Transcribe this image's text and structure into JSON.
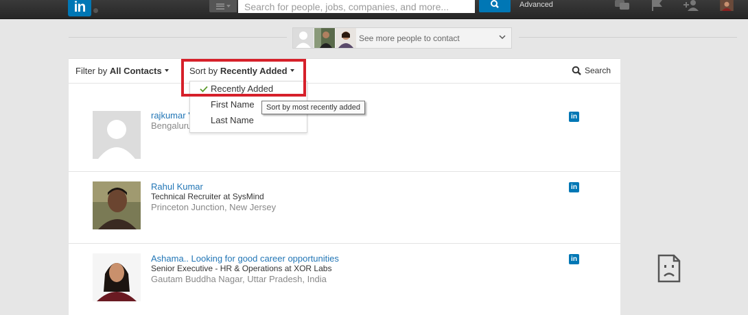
{
  "navbar": {
    "logo_text": "in",
    "search_placeholder": "Search for people, jobs, companies, and more...",
    "advanced_label": "Advanced",
    "icons": [
      "messages-icon",
      "flag-icon",
      "add-connection-icon",
      "profile-photo"
    ]
  },
  "people_strip": {
    "label": "See more people to contact"
  },
  "filter_bar": {
    "filter_prefix": "Filter by",
    "filter_value": "All Contacts",
    "sort_prefix": "Sort by",
    "sort_value": "Recently Added",
    "search_label": "Search"
  },
  "sort_menu": {
    "items": [
      "Recently Added",
      "First Name",
      "Last Name"
    ],
    "selected": "Recently Added",
    "tooltip": "Sort by most recently added"
  },
  "contacts": [
    {
      "name": "rajkumar '",
      "headline": "",
      "location": "Bengaluru",
      "badge": "in"
    },
    {
      "name": "Rahul Kumar",
      "headline": "Technical Recruiter at SysMind",
      "location": "Princeton Junction, New Jersey",
      "badge": "in"
    },
    {
      "name": "Ashama.. Looking for good career opportunities",
      "headline": "Senior Executive - HR & Operations at XOR Labs",
      "location": "Gautam Buddha Nagar, Uttar Pradesh, India",
      "badge": "in"
    }
  ],
  "colors": {
    "brand": "#0077b5",
    "highlight": "#d6202a",
    "link": "#2276b6"
  }
}
